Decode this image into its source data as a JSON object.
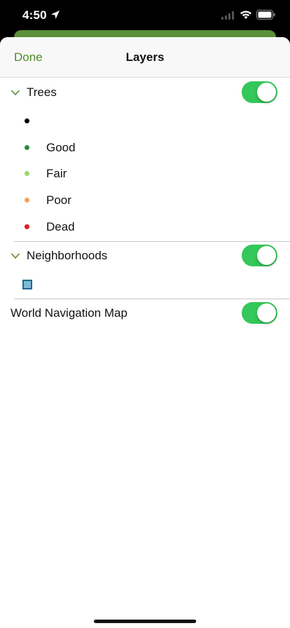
{
  "status_bar": {
    "time": "4:50",
    "icons": [
      "location-arrow-icon",
      "signal-icon",
      "wifi-icon",
      "battery-icon"
    ]
  },
  "nav": {
    "done_label": "Done",
    "title": "Layers"
  },
  "layers": {
    "trees": {
      "label": "Trees",
      "visible": true,
      "legend": [
        {
          "label": "",
          "color": "#000000"
        },
        {
          "label": "Good",
          "color": "#2a8a3c"
        },
        {
          "label": "Fair",
          "color": "#9ad86a"
        },
        {
          "label": "Poor",
          "color": "#f4a25a"
        },
        {
          "label": "Dead",
          "color": "#d91f1f"
        }
      ]
    },
    "neighborhoods": {
      "label": "Neighborhoods",
      "visible": true
    },
    "world_nav": {
      "label": "World Navigation Map",
      "visible": true
    }
  },
  "colors": {
    "accent": "#4e8a2a",
    "toggle_on": "#34c759"
  }
}
